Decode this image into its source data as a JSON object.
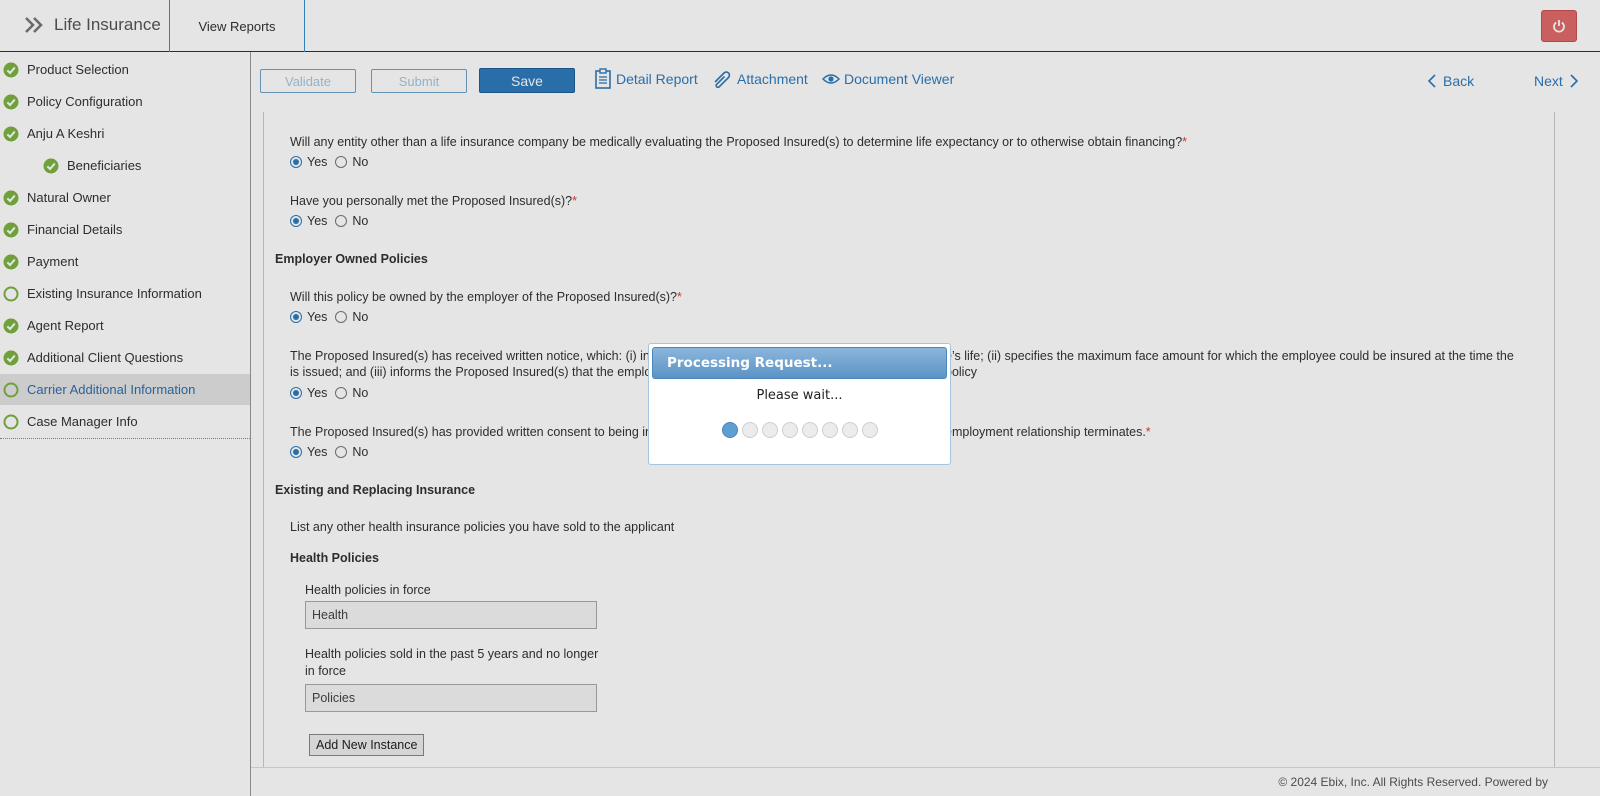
{
  "header": {
    "app_title": "Life Insurance",
    "tab_view_reports": "View Reports"
  },
  "sidebar": {
    "items": [
      {
        "label": "Product Selection",
        "status": "complete"
      },
      {
        "label": "Policy Configuration",
        "status": "complete"
      },
      {
        "label": "Anju A Keshri",
        "status": "complete"
      },
      {
        "label": "Beneficiaries",
        "status": "complete"
      },
      {
        "label": "Natural Owner",
        "status": "complete"
      },
      {
        "label": "Financial Details",
        "status": "complete"
      },
      {
        "label": "Payment",
        "status": "complete"
      },
      {
        "label": "Existing Insurance Information",
        "status": "incomplete"
      },
      {
        "label": "Agent Report",
        "status": "complete"
      },
      {
        "label": "Additional Client Questions",
        "status": "complete"
      },
      {
        "label": "Carrier Additional Information",
        "status": "incomplete",
        "active": true
      },
      {
        "label": "Case Manager Info",
        "status": "incomplete"
      }
    ]
  },
  "toolbar": {
    "validate": "Validate",
    "submit": "Submit",
    "save": "Save",
    "detail_report": "Detail Report",
    "attachment": "Attachment",
    "document_viewer": "Document Viewer",
    "back": "Back",
    "next": "Next"
  },
  "form": {
    "q1": {
      "text": "Will any entity other than a life insurance company be medically evaluating the Proposed Insured(s) to determine life expectancy or to otherwise obtain financing?",
      "selected": "Yes"
    },
    "q2": {
      "text": "Have you personally met the Proposed Insured(s)?",
      "selected": "Yes"
    },
    "section_employer": "Employer Owned Policies",
    "q3": {
      "text": "Will this policy be owned by the employer of the Proposed Insured(s)?",
      "selected": "Yes"
    },
    "q4": {
      "text_a": "The Proposed Insured(s) has received written notice, which: (i) in",
      "text_b": "e’s life; (ii) specifies the maximum face amount for which the employee could be insured at the time the policy",
      "text_c": "is issued; and (iii) informs the Proposed Insured(s) that the emplo",
      "selected": "Yes"
    },
    "q5": {
      "text_a": "The Proposed Insured(s) has provided written consent to being in",
      "text_b": "employment relationship terminates.",
      "selected": "Yes"
    },
    "yes_label": "Yes",
    "no_label": "No",
    "required_mark": "*",
    "section_existing": "Existing and Replacing Insurance",
    "list_instruction": "List any other health insurance policies you have sold to the applicant",
    "health_policies_heading": "Health Policies",
    "health_in_force_label": "Health policies in force",
    "health_in_force_value": "Health",
    "health_sold_label": "Health policies sold in the past 5 years and no longer in force",
    "health_sold_value": "Policies",
    "add_new_instance": "Add New Instance"
  },
  "footer": {
    "copyright": "© 2024 Ebix, Inc. All Rights Reserved. Powered by"
  },
  "dialog": {
    "title": "Processing Request...",
    "message": "Please wait...",
    "progress_step": 1,
    "progress_total": 8
  },
  "colors": {
    "accent": "#2f7bbd",
    "complete": "#7cb342",
    "required": "#e03a3a",
    "power_button": "#e06a6a"
  }
}
